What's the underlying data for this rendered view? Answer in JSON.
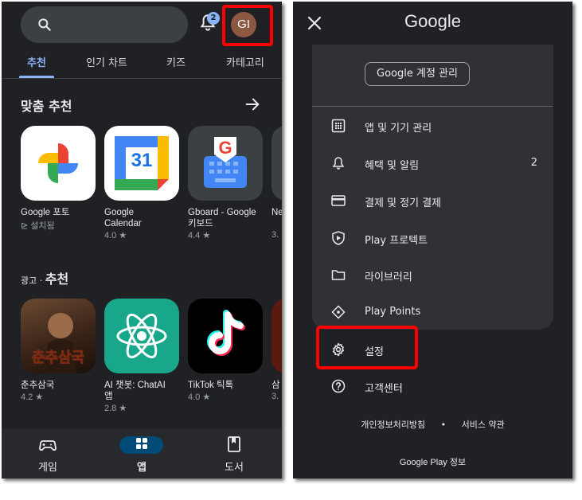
{
  "left": {
    "notification_count": "2",
    "avatar_initials": "GI",
    "tabs": [
      {
        "label": "추천"
      },
      {
        "label": "인기 차트"
      },
      {
        "label": "키즈"
      },
      {
        "label": "카테고리"
      }
    ],
    "recommended": {
      "title": "맞춤 추천",
      "apps": [
        {
          "name": "Google 포토",
          "sub": "설치됨"
        },
        {
          "name": "Google Calendar",
          "sub": "4.0 ★",
          "icon_text": "31"
        },
        {
          "name": "Gboard - Google 키보드",
          "sub": "4.4 ★"
        },
        {
          "name": "Ne",
          "sub": "3."
        }
      ]
    },
    "ads": {
      "prefix": "광고 · ",
      "title": "추천",
      "apps": [
        {
          "name": "춘추삼국",
          "sub": "4.2 ★"
        },
        {
          "name": "AI 챗봇: ChatAI 앱",
          "sub": "2.8 ★"
        },
        {
          "name": "TikTok 틱톡",
          "sub": "4.0 ★"
        },
        {
          "name": "삼",
          "sub": "3."
        }
      ]
    },
    "bottom_nav": [
      {
        "label": "게임"
      },
      {
        "label": "앱"
      },
      {
        "label": "도서"
      }
    ],
    "colors": {
      "accent": "#8ab4f8",
      "highlight": "#ff0000"
    }
  },
  "right": {
    "logo": "Google",
    "manage_button": "Google 계정 관리",
    "menu": [
      {
        "label": "앱 및 기기 관리",
        "icon": "grid-icon"
      },
      {
        "label": "혜택 및 알림",
        "icon": "bell-icon",
        "count": "2"
      },
      {
        "label": "결제 및 정기 결제",
        "icon": "card-icon"
      },
      {
        "label": "Play 프로텍트",
        "icon": "shield-play-icon"
      },
      {
        "label": "라이브러리",
        "icon": "folder-icon"
      },
      {
        "label": "Play Points",
        "icon": "diamond-icon"
      }
    ],
    "settings_label": "설정",
    "help_label": "고객센터",
    "privacy_link": "개인정보처리방침",
    "separator": "•",
    "terms_link": "서비스 약관",
    "about": "Google Play 정보"
  }
}
